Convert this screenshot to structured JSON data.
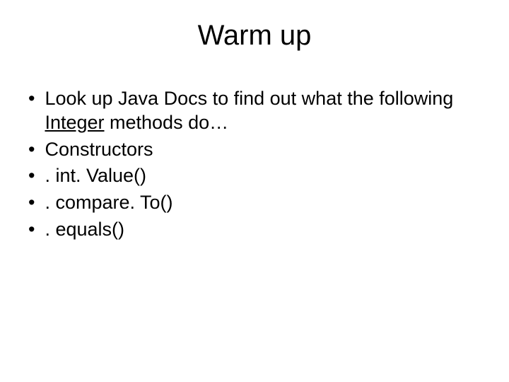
{
  "slide": {
    "title": "Warm up",
    "bullets": [
      {
        "prefix": "Look up Java Docs to find out what the following ",
        "underlined": "Integer",
        "suffix": " methods do…"
      },
      {
        "text": "Constructors"
      },
      {
        "text": ". int. Value()"
      },
      {
        "text": ". compare. To()"
      },
      {
        "text": ". equals()"
      }
    ]
  }
}
